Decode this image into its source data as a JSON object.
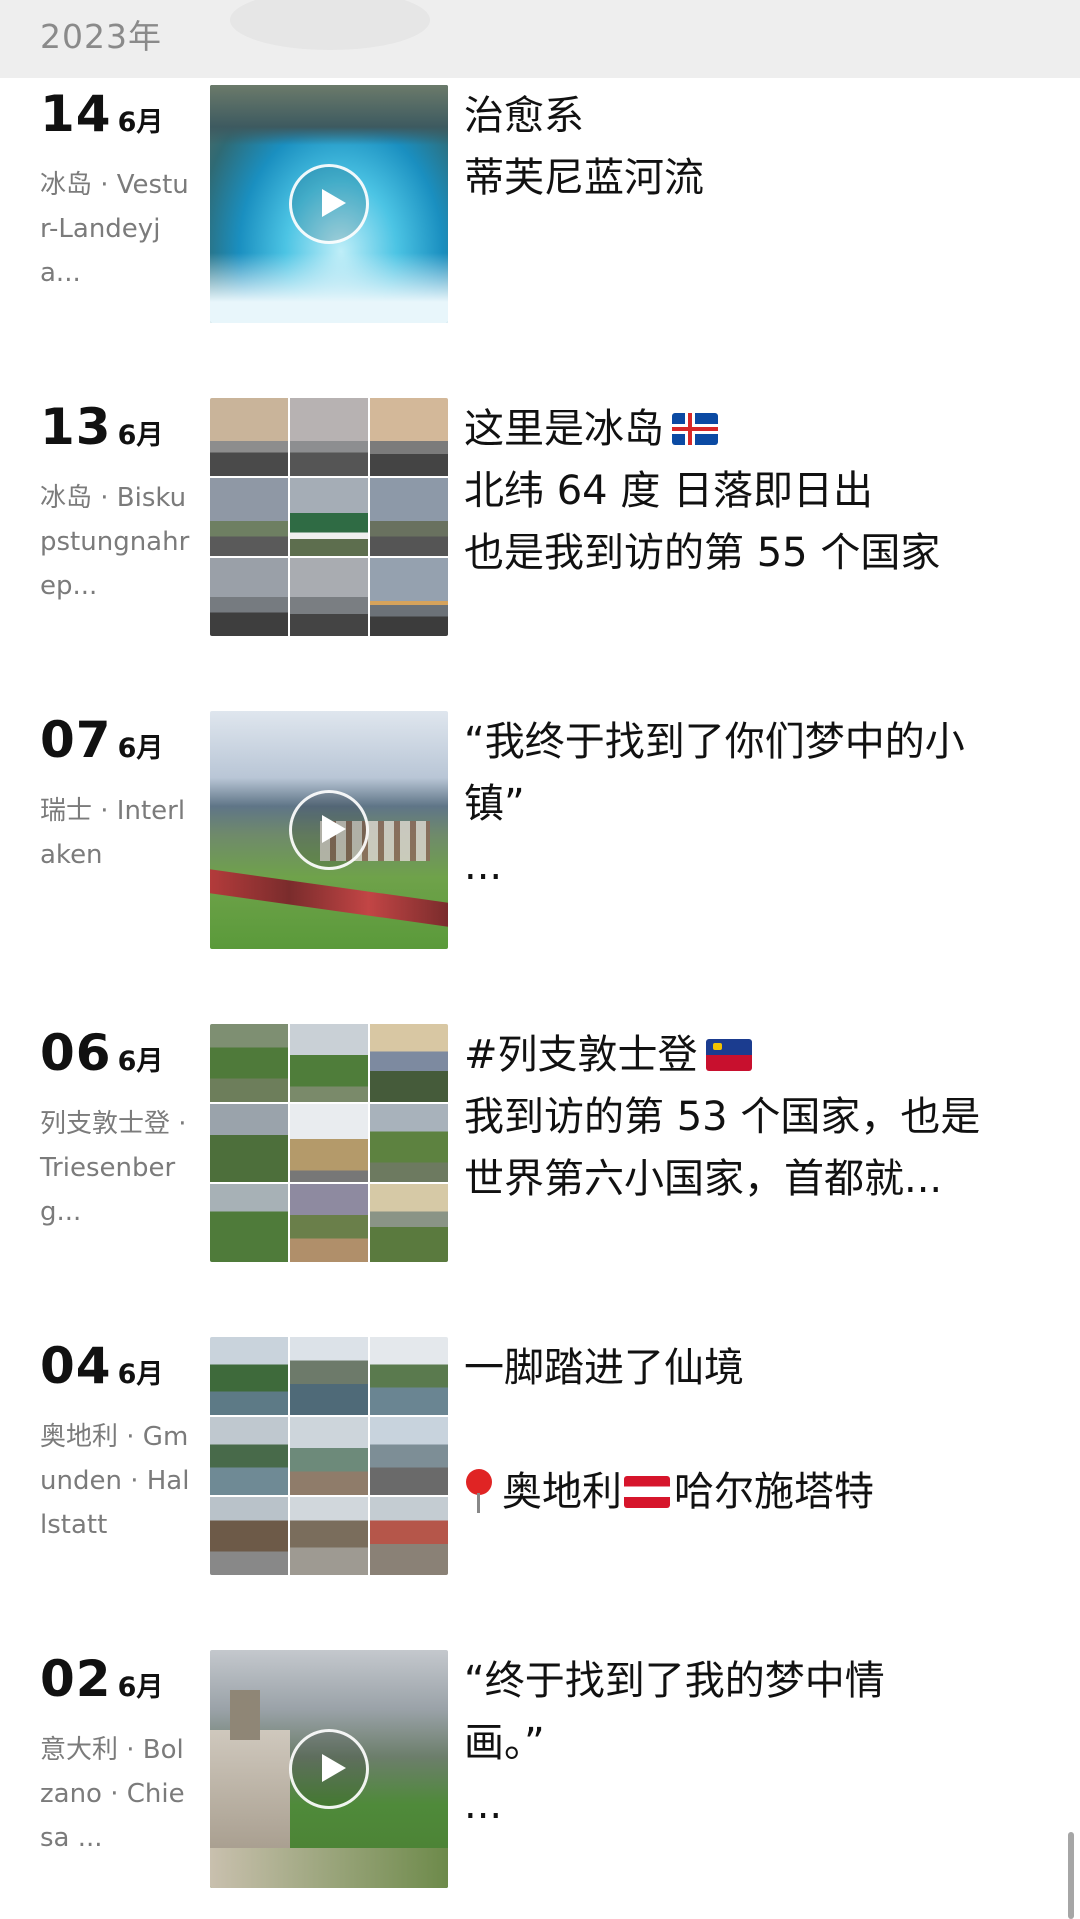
{
  "header": {
    "year": "2023年"
  },
  "posts": [
    {
      "day": "14",
      "month": "6月",
      "location": "冰岛 · Vestur-Landeyja...",
      "thumb": "video",
      "lines": [
        "治愈系",
        "蒂芙尼蓝河流"
      ]
    },
    {
      "day": "13",
      "month": "6月",
      "location": "冰岛 · Biskupstungnahrep...",
      "thumb": "grid",
      "lines": [
        "这里是冰岛",
        "北纬 64 度 日落即日出",
        "也是我到访的第 55 个国家"
      ]
    },
    {
      "day": "07",
      "month": "6月",
      "location": "瑞士 · Interlaken",
      "thumb": "video",
      "lines": [
        "“我终于找到了你们梦中的小镇”",
        "..."
      ]
    },
    {
      "day": "06",
      "month": "6月",
      "location": "列支敦士登 · Triesenberg...",
      "thumb": "grid",
      "lines": [
        "#列支敦士登",
        "我到访的第 53 个国家，也是",
        "世界第六小国家，首都就..."
      ]
    },
    {
      "day": "04",
      "month": "6月",
      "location": "奥地利 · Gmunden · Hallstatt",
      "thumb": "grid",
      "lines": [
        "一脚踏进了仙境",
        "",
        "奥地利",
        "哈尔施塔特"
      ]
    },
    {
      "day": "02",
      "month": "6月",
      "location": "意大利 · Bolzano · Chiesa ...",
      "thumb": "video",
      "lines": [
        "“终于找到了我的梦中情画。”",
        "..."
      ]
    }
  ],
  "icons": {
    "play": "play-icon",
    "iceland_flag": "iceland-flag-icon",
    "liechtenstein_flag": "liechtenstein-flag-icon",
    "austria_flag": "austria-flag-icon",
    "pin": "location-pin-icon"
  },
  "colors": {
    "header_bg": "#eeeeee",
    "year_text": "#8a8a8a",
    "location_text": "#7b7b7b",
    "body_text": "#111111"
  }
}
